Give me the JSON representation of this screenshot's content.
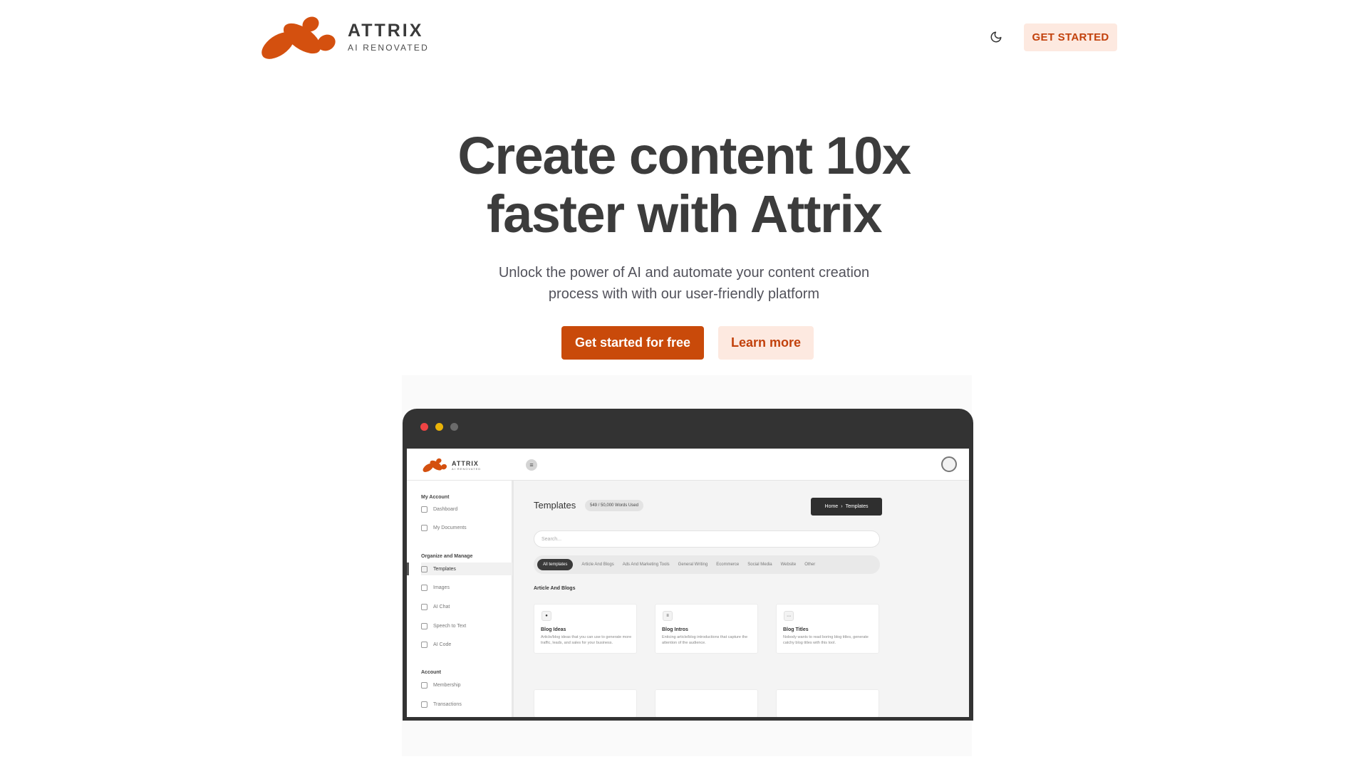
{
  "header": {
    "logo_name": "ATTRIX",
    "logo_tagline": "AI RENOVATED",
    "theme_toggle_icon": "moon-icon",
    "cta_label": "GET STARTED"
  },
  "hero": {
    "title_line1": "Create content 10x",
    "title_line2": "faster with Attrix",
    "subtitle_line1": "Unlock the power of AI and automate your content creation",
    "subtitle_line2": "process with with our user-friendly platform",
    "primary_button": "Get started for free",
    "secondary_button": "Learn more"
  },
  "preview": {
    "app_logo_name": "ATTRIX",
    "app_logo_tagline": "AI RENOVATED",
    "sidebar": {
      "section1": "My Account",
      "item_dashboard": "Dashboard",
      "item_documents": "My Documents",
      "section2": "Organize and Manage",
      "item_templates": "Templates",
      "item_images": "Images",
      "item_ai_chat": "AI Chat",
      "item_speech": "Speech to Text",
      "item_ai_code": "AI Code",
      "section3": "Account",
      "item_membership": "Membership",
      "item_transactions": "Transactions"
    },
    "main": {
      "title": "Templates",
      "words_badge": "549 / 50,000 Words Used",
      "breadcrumb_home": "Home",
      "breadcrumb_sep": "›",
      "breadcrumb_current": "Templates",
      "search_placeholder": "Search...",
      "tabs": [
        "All templates",
        "Article And Blogs",
        "Ads And Marketing Tools",
        "General Writing",
        "Ecommerce",
        "Social Media",
        "Website",
        "Other"
      ],
      "section_heading": "Article And Blogs",
      "cards": [
        {
          "title": "Blog Ideas",
          "desc": "Article/blog ideas that you can use to generate more traffic, leads, and sales for your business."
        },
        {
          "title": "Blog Intros",
          "desc": "Enticing article/blog introductions that capture the attention of the audience."
        },
        {
          "title": "Blog Titles",
          "desc": "Nobody wants to read boring blog titles, generate catchy blog titles with this tool."
        }
      ]
    }
  },
  "colors": {
    "brand": "#c94a0a",
    "brand_light": "#fde9e0",
    "heading": "#3c3c3c"
  }
}
